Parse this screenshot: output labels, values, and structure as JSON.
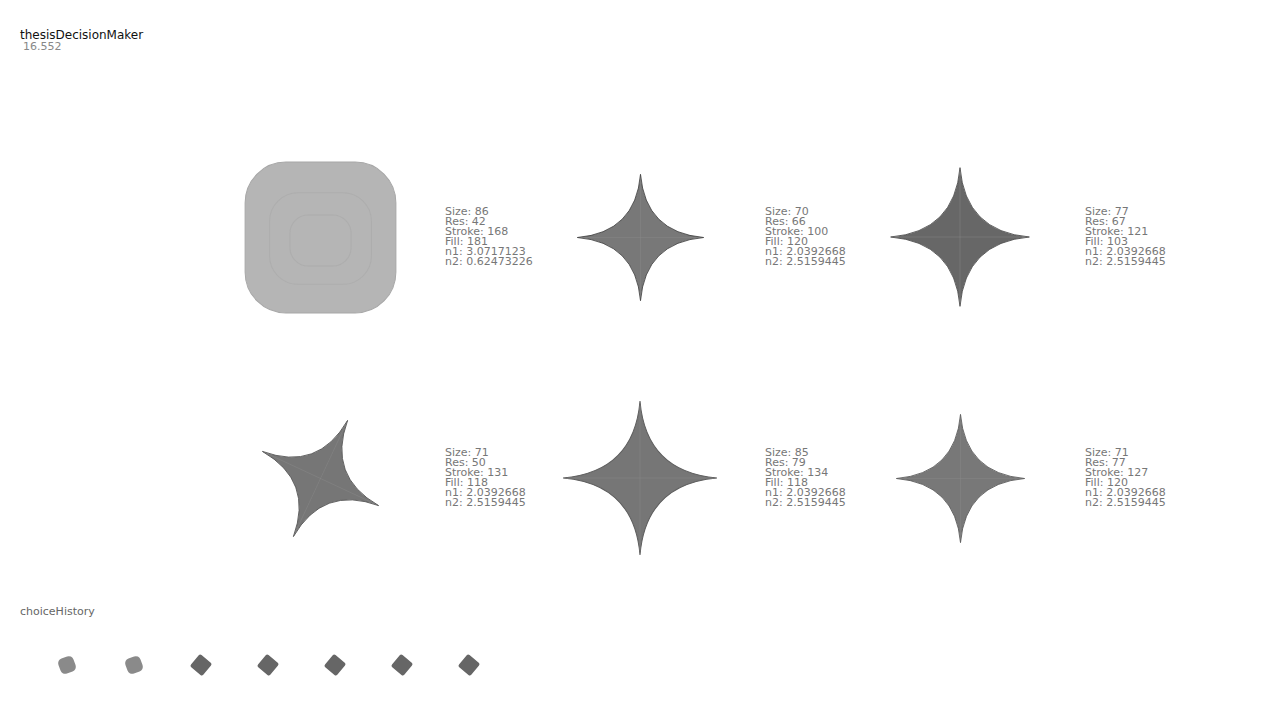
{
  "window": {
    "title": "thesisDecisionMaker",
    "fps": "16.552"
  },
  "options": [
    {
      "kind": "rounded",
      "tilt": 0,
      "size": "86",
      "res": "42",
      "stroke": "168",
      "fill": "181",
      "n1": "3.0717123",
      "n2": "0.62473226"
    },
    {
      "kind": "star",
      "tilt": 0,
      "size": "70",
      "res": "66",
      "stroke": "100",
      "fill": "120",
      "n1": "2.0392668",
      "n2": "2.5159445"
    },
    {
      "kind": "star",
      "tilt": 0,
      "size": "77",
      "res": "67",
      "stroke": "121",
      "fill": "103",
      "n1": "2.0392668",
      "n2": "2.5159445"
    },
    {
      "kind": "star",
      "tilt": 25,
      "size": "71",
      "res": "50",
      "stroke": "131",
      "fill": "118",
      "n1": "2.0392668",
      "n2": "2.5159445"
    },
    {
      "kind": "star",
      "tilt": 0,
      "size": "85",
      "res": "79",
      "stroke": "134",
      "fill": "118",
      "n1": "2.0392668",
      "n2": "2.5159445"
    },
    {
      "kind": "star",
      "tilt": 0,
      "size": "71",
      "res": "77",
      "stroke": "127",
      "fill": "120",
      "n1": "2.0392668",
      "n2": "2.5159445"
    }
  ],
  "history": {
    "label": "choiceHistory",
    "items": [
      {
        "kind": "rounded"
      },
      {
        "kind": "rounded"
      },
      {
        "kind": "star"
      },
      {
        "kind": "star"
      },
      {
        "kind": "star"
      },
      {
        "kind": "star"
      },
      {
        "kind": "star"
      }
    ]
  }
}
